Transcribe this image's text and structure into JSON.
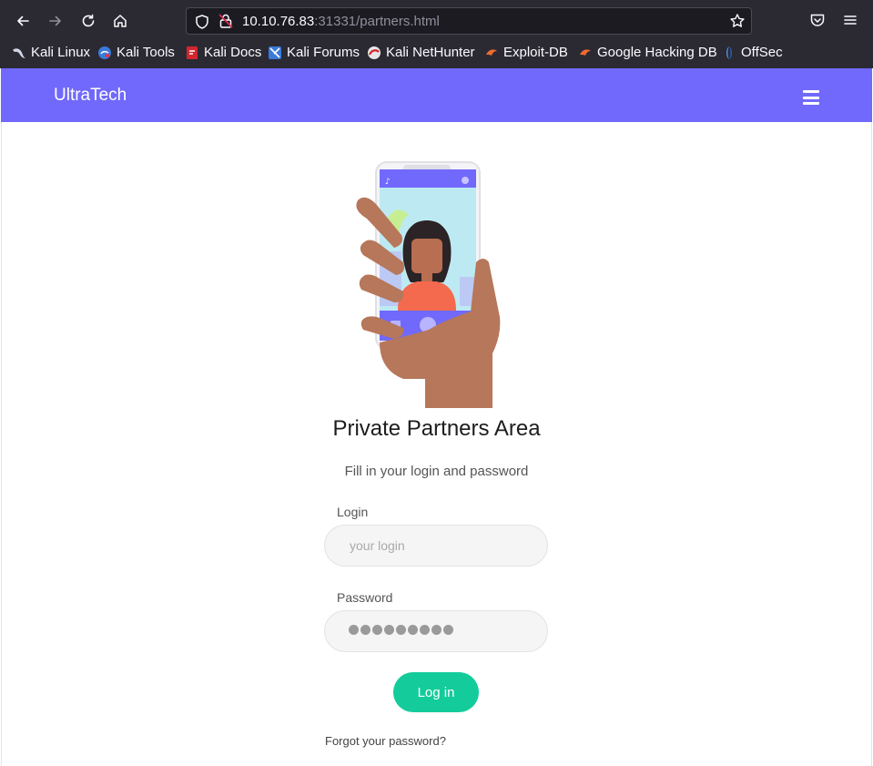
{
  "browser": {
    "url_host": "10.10.76.83",
    "url_rest": ":31331/partners.html",
    "bookmarks": [
      {
        "label": "Kali Linux",
        "icon": "kali-dragon-icon"
      },
      {
        "label": "Kali Tools",
        "icon": "kali-tools-icon"
      },
      {
        "label": "Kali Docs",
        "icon": "kali-docs-icon"
      },
      {
        "label": "Kali Forums",
        "icon": "kali-forums-icon"
      },
      {
        "label": "Kali NetHunter",
        "icon": "kali-nethunter-icon"
      },
      {
        "label": "Exploit-DB",
        "icon": "exploit-db-icon"
      },
      {
        "label": "Google Hacking DB",
        "icon": "ghdb-icon"
      },
      {
        "label": "OffSec",
        "icon": "offsec-icon"
      }
    ]
  },
  "site": {
    "brand": "UltraTech"
  },
  "form": {
    "title": "Private Partners Area",
    "subtitle": "Fill in your login and password",
    "login_label": "Login",
    "login_placeholder": "your login",
    "password_label": "Password",
    "password_mask_length": 9,
    "submit_label": "Log in",
    "forgot_link": "Forgot your password?"
  },
  "colors": {
    "navbar": "#7169fb",
    "button": "#14cc9b",
    "chrome": "#2b2a33"
  }
}
